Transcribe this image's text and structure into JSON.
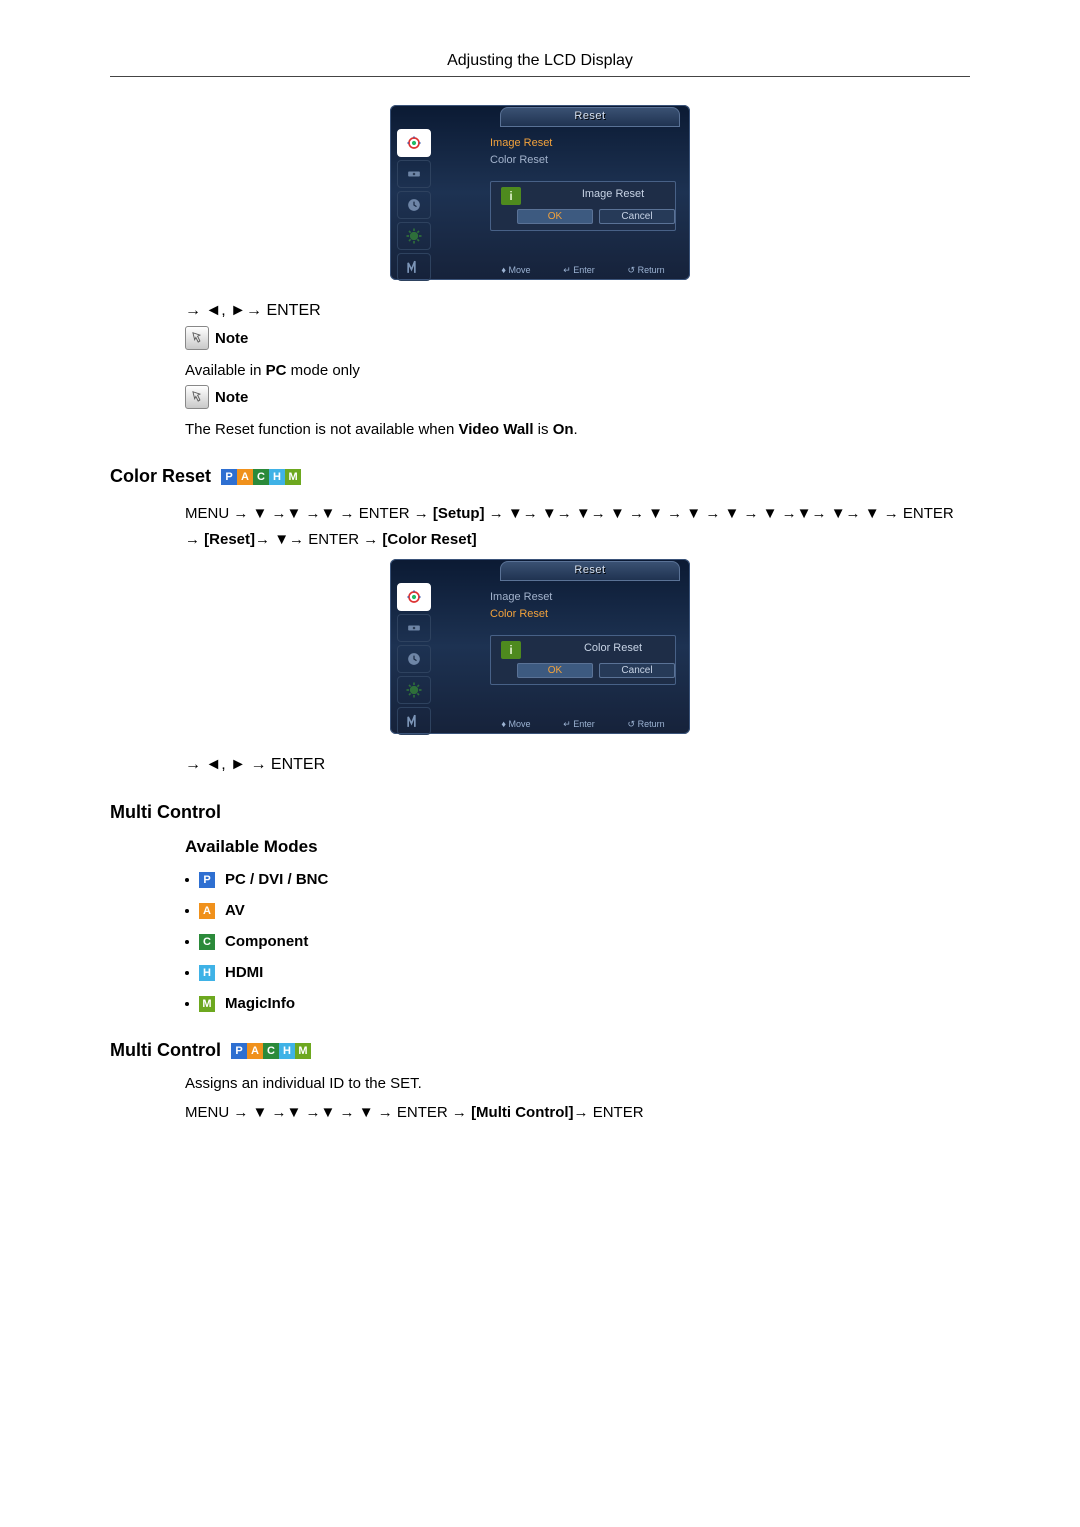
{
  "header": {
    "title": "Adjusting the LCD Display"
  },
  "osd1": {
    "tab": "Reset",
    "menu_items": [
      "Image Reset",
      "Color Reset"
    ],
    "highlight": 0,
    "dialog": {
      "label": "Image Reset",
      "ok": "OK",
      "cancel": "Cancel"
    },
    "footer": {
      "move": "Move",
      "enter": "Enter",
      "return": "Return"
    }
  },
  "osd2": {
    "tab": "Reset",
    "menu_items": [
      "Image Reset",
      "Color Reset"
    ],
    "highlight": 1,
    "dialog": {
      "label": "Color Reset",
      "ok": "OK",
      "cancel": "Cancel"
    },
    "footer": {
      "move": "Move",
      "enter": "Enter",
      "return": "Return"
    }
  },
  "navline1": "→ ◄, ►→ ENTER",
  "note_label": "Note",
  "note1_text_a": "Available in ",
  "note1_bold": "PC",
  "note1_text_b": " mode only",
  "note2_text_a": "The Reset function is not available when ",
  "note2_bold1": "Video Wall",
  "note2_text_b": " is ",
  "note2_bold2": "On",
  "note2_text_c": ".",
  "section_color_reset": "Color Reset",
  "menuflow1_a": "MENU → ▼ →▼ →▼ → ENTER → ",
  "menuflow1_bracket1": "[Setup]",
  "menuflow1_b": " → ▼→ ▼→ ▼→ ▼ → ▼ → ▼ → ▼ → ▼ →▼→ ▼→ ▼ → ENTER → ",
  "menuflow1_bracket2": "[Reset]",
  "menuflow1_c": "→ ▼→ ENTER → ",
  "menuflow1_bracket3": "[Color Reset]",
  "navline2": "→ ◄, ► → ENTER",
  "section_multi_control": "Multi Control",
  "heading_available_modes": "Available Modes",
  "modes": {
    "p": "PC / DVI / BNC",
    "a": "AV",
    "c": "Component",
    "h": "HDMI",
    "m": "MagicInfo"
  },
  "section_multi_control2": "Multi Control",
  "mc_desc": "Assigns an individual ID to the SET.",
  "menuflow2_a": "MENU → ▼ →▼ →▼ → ▼ → ENTER → ",
  "menuflow2_bracket": "[Multi Control]",
  "menuflow2_b": "→ ENTER"
}
